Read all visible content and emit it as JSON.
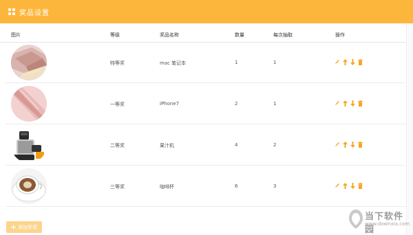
{
  "header": {
    "title": "奖品设置",
    "icon": "grid-icon",
    "color": "#fdb63c"
  },
  "columns": {
    "image": "图片",
    "level": "等级",
    "name": "奖品名称",
    "quantity": "数量",
    "per_draw": "每次抽取",
    "actions": "操作"
  },
  "rows": [
    {
      "level": "特等奖",
      "name": "mac 笔记本",
      "quantity": "1",
      "per_draw": "1",
      "image": "laptop"
    },
    {
      "level": "一等奖",
      "name": "iPhone7",
      "quantity": "2",
      "per_draw": "1",
      "image": "phone"
    },
    {
      "level": "二等奖",
      "name": "果汁机",
      "quantity": "4",
      "per_draw": "2",
      "image": "juicer"
    },
    {
      "level": "三等奖",
      "name": "咖啡杯",
      "quantity": "6",
      "per_draw": "3",
      "image": "coffee-cup"
    }
  ],
  "action_icons": [
    "edit-icon",
    "move-up-icon",
    "move-down-icon",
    "delete-icon"
  ],
  "add_button": {
    "label": "添加奖项"
  },
  "watermark": {
    "text": "当下软件园",
    "url": "www.downxia.com"
  },
  "colors": {
    "accent": "#fdb63c",
    "action": "#f5a623"
  }
}
